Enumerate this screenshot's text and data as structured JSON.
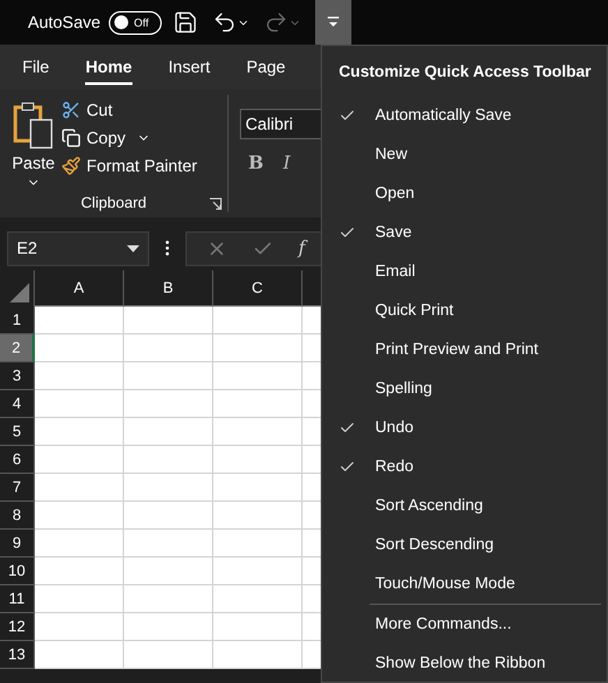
{
  "title_bar": {
    "autosave_label": "AutoSave",
    "autosave_toggle": {
      "label": "Off",
      "on": false
    },
    "quick_access": [
      {
        "kind": "save",
        "disabled": false
      },
      {
        "kind": "undo",
        "disabled": false
      },
      {
        "kind": "redo",
        "disabled": true
      }
    ],
    "customize_button": {
      "selected": true
    }
  },
  "ribbon": {
    "tabs": [
      {
        "label": "File",
        "selected": false
      },
      {
        "label": "Home",
        "selected": true
      },
      {
        "label": "Insert",
        "selected": false
      },
      {
        "label": "Page",
        "selected": false
      }
    ],
    "clipboard": {
      "paste": "Paste",
      "cut": "Cut",
      "copy": "Copy",
      "format_painter": "Format Painter",
      "group_label": "Clipboard"
    },
    "font": {
      "name": "Calibri",
      "bold": "B",
      "italic": "I"
    }
  },
  "formula_bar": {
    "name_box": "E2",
    "function_label": "f"
  },
  "sheet": {
    "columns": [
      {
        "label": "A",
        "selected": false
      },
      {
        "label": "B",
        "selected": false
      },
      {
        "label": "C",
        "selected": false
      }
    ],
    "rows": [
      {
        "label": "1",
        "selected": false
      },
      {
        "label": "2",
        "selected": true
      },
      {
        "label": "3",
        "selected": false
      },
      {
        "label": "4",
        "selected": false
      },
      {
        "label": "5",
        "selected": false
      },
      {
        "label": "6",
        "selected": false
      },
      {
        "label": "7",
        "selected": false
      },
      {
        "label": "8",
        "selected": false
      },
      {
        "label": "9",
        "selected": false
      },
      {
        "label": "10",
        "selected": false
      },
      {
        "label": "11",
        "selected": false
      },
      {
        "label": "12",
        "selected": false
      },
      {
        "label": "13",
        "selected": false
      }
    ]
  },
  "menu": {
    "title": "Customize Quick Access Toolbar",
    "items": [
      {
        "label": "Automatically Save",
        "checked": true,
        "separator_before": false
      },
      {
        "label": "New",
        "checked": false,
        "separator_before": false
      },
      {
        "label": "Open",
        "checked": false,
        "separator_before": false
      },
      {
        "label": "Save",
        "checked": true,
        "separator_before": false
      },
      {
        "label": "Email",
        "checked": false,
        "separator_before": false
      },
      {
        "label": "Quick Print",
        "checked": false,
        "separator_before": false
      },
      {
        "label": "Print Preview and Print",
        "checked": false,
        "separator_before": false
      },
      {
        "label": "Spelling",
        "checked": false,
        "separator_before": false
      },
      {
        "label": "Undo",
        "checked": true,
        "separator_before": false
      },
      {
        "label": "Redo",
        "checked": true,
        "separator_before": false
      },
      {
        "label": "Sort Ascending",
        "checked": false,
        "separator_before": false
      },
      {
        "label": "Sort Descending",
        "checked": false,
        "separator_before": false
      },
      {
        "label": "Touch/Mouse Mode",
        "checked": false,
        "separator_before": false
      },
      {
        "label": "More Commands...",
        "checked": false,
        "separator_before": true
      },
      {
        "label": "Show Below the Ribbon",
        "checked": false,
        "separator_before": false
      }
    ]
  }
}
